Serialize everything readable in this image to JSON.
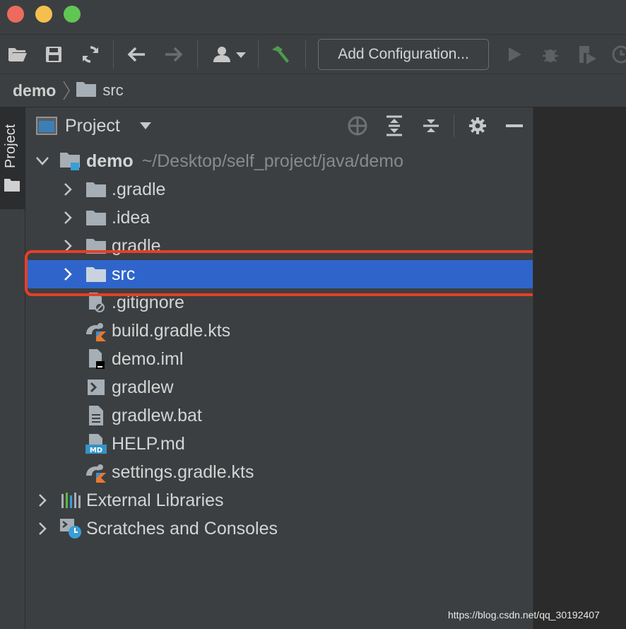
{
  "window": {
    "buttons": [
      "close",
      "minimize",
      "maximize"
    ]
  },
  "toolbar": {
    "add_configuration_label": "Add Configuration...",
    "icons": [
      "open-folder-icon",
      "save-icon",
      "sync-icon",
      "back-arrow-icon",
      "forward-arrow-icon",
      "user-icon",
      "build-hammer-icon",
      "run-icon",
      "debug-icon",
      "coverage-icon",
      "profile-icon"
    ]
  },
  "breadcrumb": {
    "root": "demo",
    "child": "src"
  },
  "side_strip": {
    "tab_label": "Project"
  },
  "project_panel": {
    "title": "Project"
  },
  "tree": {
    "root": {
      "name": "demo",
      "path": "~/Desktop/self_project/java/demo"
    },
    "items": [
      {
        "name": ".gradle",
        "kind": "folder"
      },
      {
        "name": ".idea",
        "kind": "folder"
      },
      {
        "name": "gradle",
        "kind": "folder"
      },
      {
        "name": "src",
        "kind": "folder",
        "selected": true
      },
      {
        "name": ".gitignore",
        "kind": "ignored-file"
      },
      {
        "name": "build.gradle.kts",
        "kind": "gradle-kts"
      },
      {
        "name": "demo.iml",
        "kind": "iml"
      },
      {
        "name": "gradlew",
        "kind": "shell"
      },
      {
        "name": "gradlew.bat",
        "kind": "text"
      },
      {
        "name": "HELP.md",
        "kind": "markdown"
      },
      {
        "name": "settings.gradle.kts",
        "kind": "gradle-kts"
      }
    ],
    "external_libraries": "External Libraries",
    "scratches": "Scratches and Consoles"
  },
  "colors": {
    "selection": "#2f65ca",
    "highlight_box": "#e53f27",
    "panel_bg": "#3c3f41"
  },
  "watermark": "https://blog.csdn.net/qq_30192407"
}
